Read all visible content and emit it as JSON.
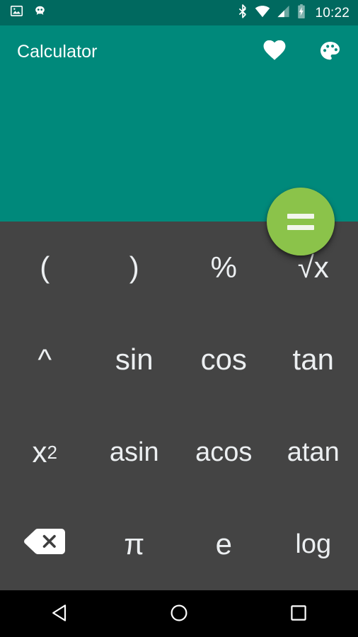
{
  "status_bar": {
    "background_color": "#00695F",
    "left_icons": [
      {
        "name": "image-icon",
        "label": "Screenshot"
      },
      {
        "name": "cyanogenmod-icon",
        "label": "CyanogenMod"
      }
    ],
    "right_icons": [
      {
        "name": "bluetooth-icon",
        "label": "Bluetooth"
      },
      {
        "name": "wifi-icon",
        "label": "Wi-Fi"
      },
      {
        "name": "cellular-signal-icon",
        "label": "Signal"
      },
      {
        "name": "battery-charging-icon",
        "label": "Charging"
      }
    ],
    "clock": "10:22"
  },
  "app_bar": {
    "title": "Calculator",
    "background_color": "#00897B",
    "actions": [
      {
        "name": "favorite-icon",
        "label": "Favorite"
      },
      {
        "name": "palette-icon",
        "label": "Theme"
      }
    ]
  },
  "display": {
    "expression": "",
    "result": "",
    "background_color": "#00897B"
  },
  "fab": {
    "name": "equals-button",
    "label": "=",
    "color": "#8BC34A"
  },
  "keypad": {
    "background_color": "#444444",
    "text_color": "#ECEFF1",
    "rows": [
      [
        {
          "name": "key-open-paren",
          "label": "(",
          "type": "text"
        },
        {
          "name": "key-close-paren",
          "label": ")",
          "type": "text"
        },
        {
          "name": "key-percent",
          "label": "%",
          "type": "text"
        },
        {
          "name": "key-sqrt",
          "label": "√x",
          "type": "text"
        }
      ],
      [
        {
          "name": "key-power",
          "label": "^",
          "type": "text"
        },
        {
          "name": "key-sin",
          "label": "sin",
          "type": "text"
        },
        {
          "name": "key-cos",
          "label": "cos",
          "type": "text"
        },
        {
          "name": "key-tan",
          "label": "tan",
          "type": "text"
        }
      ],
      [
        {
          "name": "key-square",
          "label": "x²",
          "type": "text",
          "base": "x",
          "exponent": "2"
        },
        {
          "name": "key-asin",
          "label": "asin",
          "type": "text"
        },
        {
          "name": "key-acos",
          "label": "acos",
          "type": "text"
        },
        {
          "name": "key-atan",
          "label": "atan",
          "type": "text"
        }
      ],
      [
        {
          "name": "key-backspace",
          "label": "",
          "type": "icon",
          "icon": "backspace-icon"
        },
        {
          "name": "key-pi",
          "label": "π",
          "type": "text"
        },
        {
          "name": "key-e",
          "label": "e",
          "type": "text"
        },
        {
          "name": "key-log",
          "label": "log",
          "type": "text"
        }
      ]
    ]
  },
  "nav_bar": {
    "background_color": "#000000",
    "buttons": [
      {
        "name": "nav-back-button",
        "label": "Back"
      },
      {
        "name": "nav-home-button",
        "label": "Home"
      },
      {
        "name": "nav-recents-button",
        "label": "Recents"
      }
    ]
  }
}
